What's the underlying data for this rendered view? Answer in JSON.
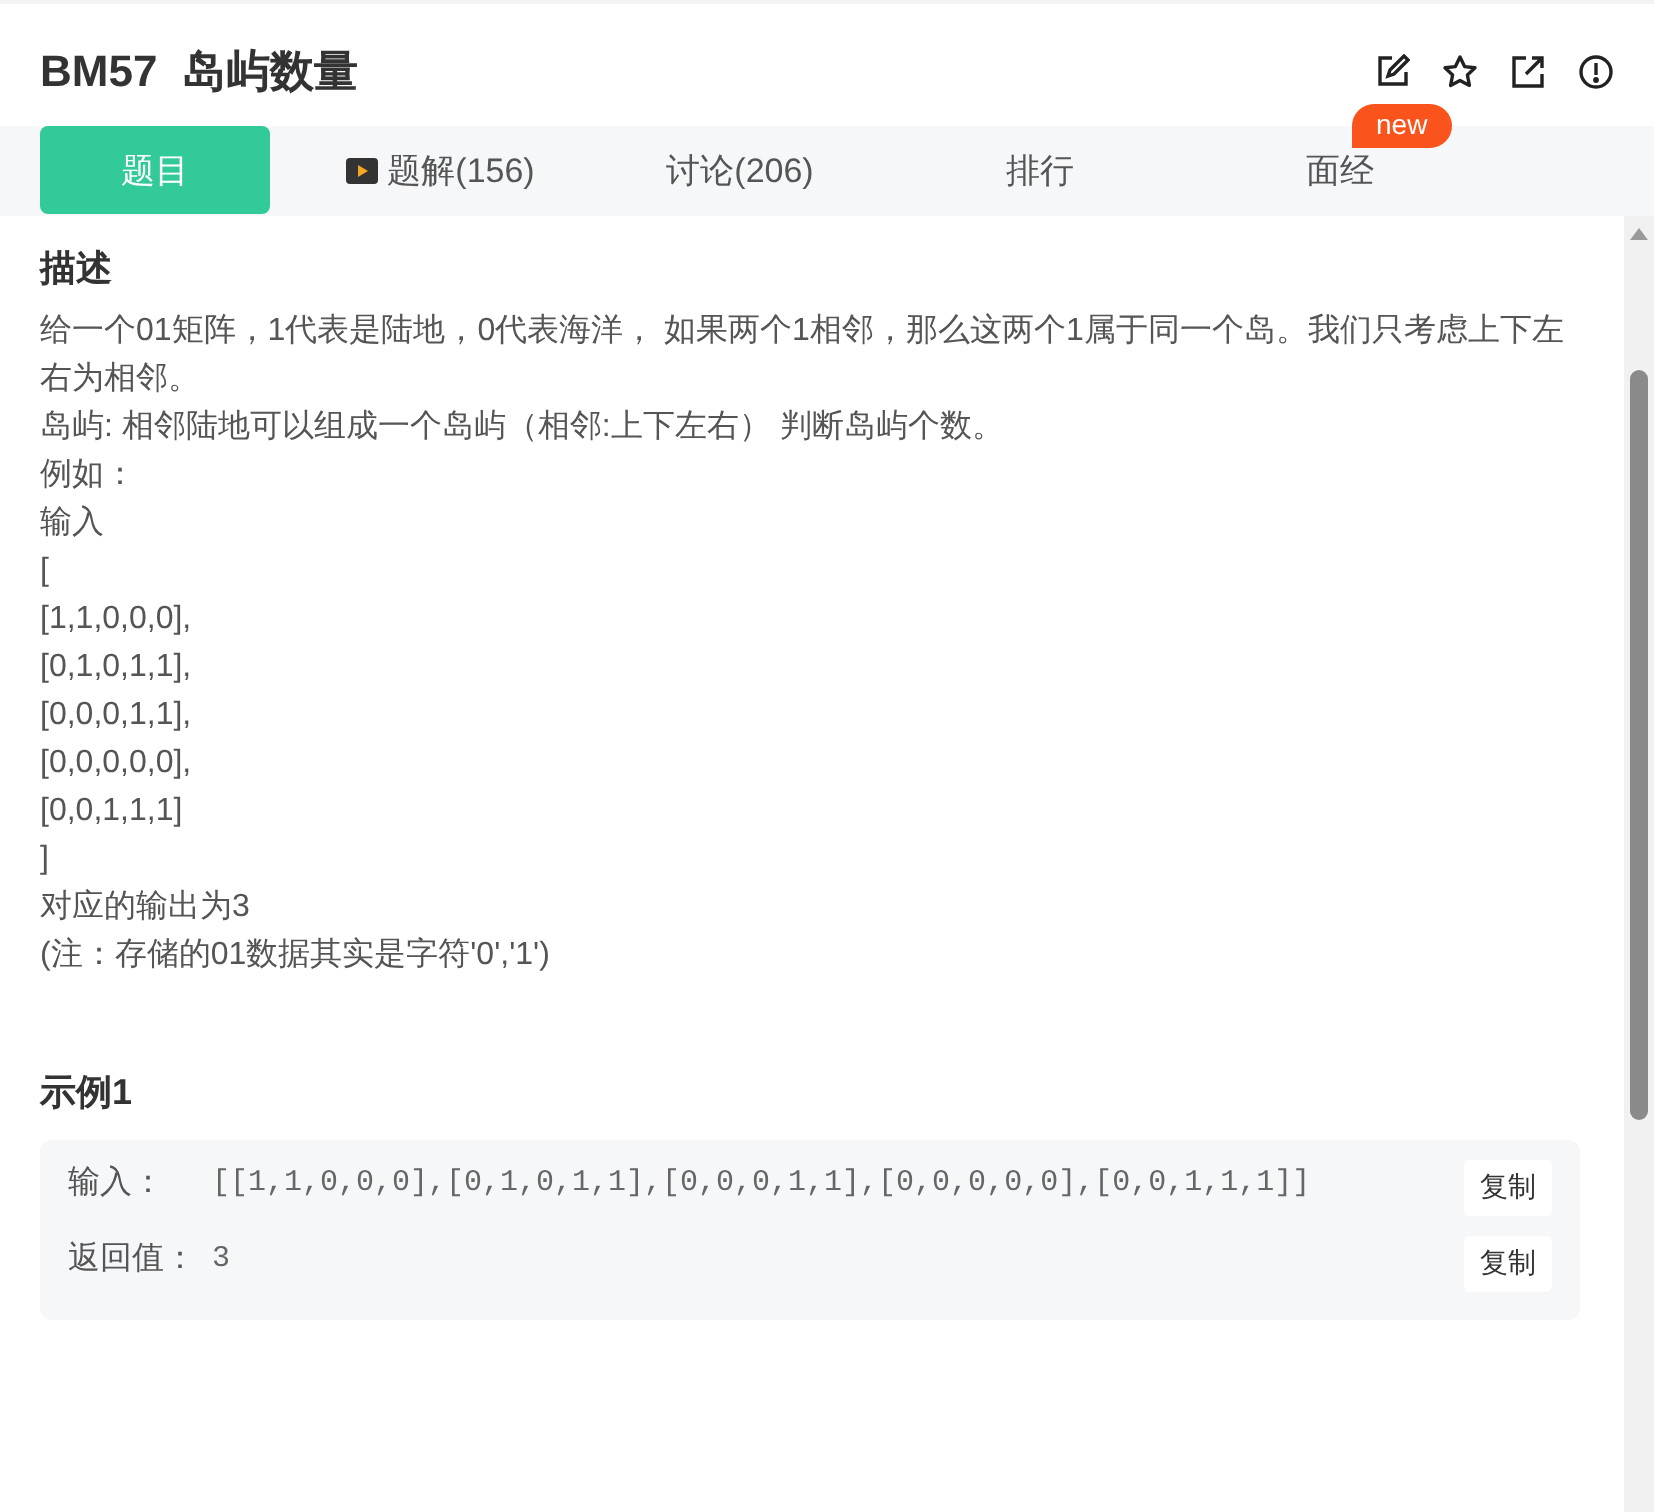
{
  "header": {
    "code": "BM57",
    "title": "岛屿数量"
  },
  "tabs": [
    {
      "label": "题目",
      "selected": true,
      "kind": "plain"
    },
    {
      "label": "题解(156)",
      "selected": false,
      "kind": "video"
    },
    {
      "label": "讨论(206)",
      "selected": false,
      "kind": "plain"
    },
    {
      "label": "排行",
      "selected": false,
      "kind": "plain"
    },
    {
      "label": "面经",
      "selected": false,
      "kind": "plain",
      "badge": "new"
    }
  ],
  "description": {
    "heading": "描述",
    "lines": [
      "给一个01矩阵，1代表是陆地，0代表海洋， 如果两个1相邻，那么这两个1属于同一个岛。我们只考虑上下左右为相邻。",
      "岛屿: 相邻陆地可以组成一个岛屿（相邻:上下左右） 判断岛屿个数。",
      "例如：",
      "输入",
      "[",
      "[1,1,0,0,0],",
      "[0,1,0,1,1],",
      "[0,0,0,1,1],",
      "[0,0,0,0,0],",
      "[0,0,1,1,1]",
      "]",
      "对应的输出为3",
      "(注：存储的01数据其实是字符'0','1')"
    ]
  },
  "example": {
    "heading": "示例1",
    "rows": [
      {
        "label": "输入：",
        "value": "[[1,1,0,0,0],[0,1,0,1,1],[0,0,0,1,1],[0,0,0,0,0],[0,0,1,1,1]]",
        "copy": "复制"
      },
      {
        "label": "返回值：",
        "value": "3",
        "copy": "复制"
      }
    ]
  }
}
